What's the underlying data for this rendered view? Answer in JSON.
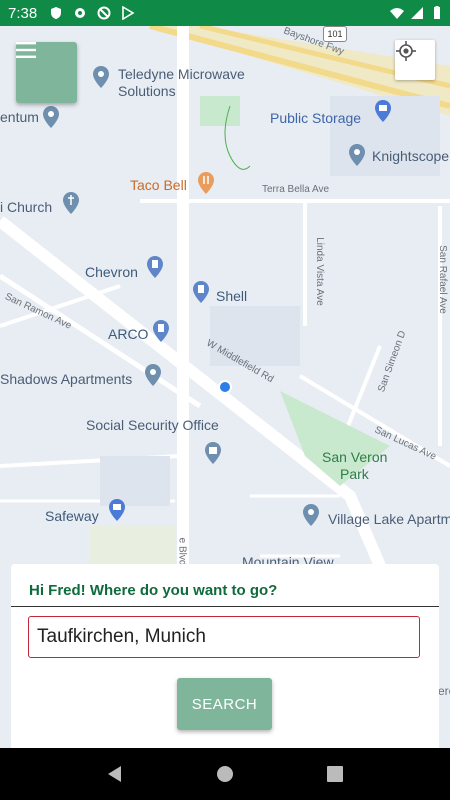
{
  "status_bar": {
    "time": "7:38",
    "icons_left": [
      "shield-icon",
      "gear-icon",
      "do-not-disturb-icon",
      "play-store-icon"
    ],
    "icons_right": [
      "wifi-icon",
      "signal-icon",
      "battery-icon"
    ]
  },
  "map": {
    "places": [
      {
        "name": "Teledyne Microwave"
      },
      {
        "name": "Solutions"
      },
      {
        "name": "Public Storage"
      },
      {
        "name": "Knightscope"
      },
      {
        "name": "entum"
      },
      {
        "name": "Taco Bell"
      },
      {
        "name": "i Church"
      },
      {
        "name": "Chevron"
      },
      {
        "name": "Shell"
      },
      {
        "name": "ARCO"
      },
      {
        "name": "Shadows Apartments"
      },
      {
        "name": "Social Security Office"
      },
      {
        "name": "San Veron"
      },
      {
        "name": "Park"
      },
      {
        "name": "Safeway"
      },
      {
        "name": "Village Lake Apartm"
      },
      {
        "name": "Mountain View"
      }
    ],
    "roads": [
      {
        "name": "Bayshore Fwy"
      },
      {
        "name": "101"
      },
      {
        "name": "Terra Bella Ave"
      },
      {
        "name": "Linda Vista Ave"
      },
      {
        "name": "San Rafael Ave"
      },
      {
        "name": "San Ramon Ave"
      },
      {
        "name": "W Middlefield Rd"
      },
      {
        "name": "San Simeon D"
      },
      {
        "name": "San Lucas Ave"
      },
      {
        "name": "e Blvd"
      },
      {
        "name": "ere"
      }
    ]
  },
  "card": {
    "greeting": "Hi Fred! Where do you want to go?",
    "destination_value": "Taufkirchen, Munich",
    "search_label": "SEARCH"
  },
  "colors": {
    "status_bar": "#0f8a47",
    "accent_button": "#7fb59a",
    "greeting_text": "#0f6b3c",
    "input_border": "#c0283a"
  }
}
